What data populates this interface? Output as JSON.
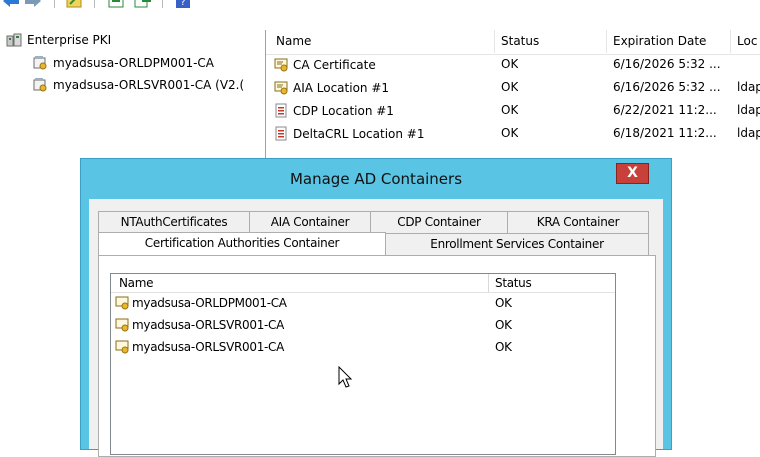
{
  "toolbar": {
    "icons": [
      "back-arrow-icon",
      "forward-arrow-icon",
      "properties-icon",
      "export-icon",
      "refresh-icon",
      "help-icon"
    ]
  },
  "tree": {
    "root": "Enterprise PKI",
    "children": [
      "myadsusa-ORLDPM001-CA",
      "myadsusa-ORLSVR001-CA (V2.("
    ]
  },
  "list": {
    "columns": [
      "Name",
      "Status",
      "Expiration Date",
      "Loc"
    ],
    "rows": [
      {
        "name": "CA Certificate",
        "status": "OK",
        "expiration": "6/16/2026 5:32 ...",
        "location": "",
        "icon": "certificate-icon"
      },
      {
        "name": "AIA Location #1",
        "status": "OK",
        "expiration": "6/16/2026 5:32 ...",
        "location": "ldap",
        "icon": "certificate-icon"
      },
      {
        "name": "CDP Location #1",
        "status": "OK",
        "expiration": "6/22/2021 11:2...",
        "location": "ldap",
        "icon": "crl-icon"
      },
      {
        "name": "DeltaCRL Location #1",
        "status": "OK",
        "expiration": "6/18/2021 11:2...",
        "location": "ldap",
        "icon": "crl-icon"
      }
    ]
  },
  "dialog": {
    "title": "Manage AD Containers",
    "close_label": "X",
    "tabs_row1": [
      "NTAuthCertificates",
      "AIA Container",
      "CDP Container",
      "KRA Container"
    ],
    "tabs_row2": [
      "Certification Authorities Container",
      "Enrollment Services Container"
    ],
    "active_tab": "Certification Authorities Container",
    "list": {
      "columns": [
        "Name",
        "Status"
      ],
      "rows": [
        {
          "name": "myadsusa-ORLDPM001-CA",
          "status": "OK"
        },
        {
          "name": "myadsusa-ORLSVR001-CA",
          "status": "OK"
        },
        {
          "name": "myadsusa-ORLSVR001-CA",
          "status": "OK"
        }
      ]
    }
  },
  "colors": {
    "dialog_frame": "#5ac4e4",
    "close_button": "#c7403a",
    "dialog_client": "#f0f0f0"
  }
}
